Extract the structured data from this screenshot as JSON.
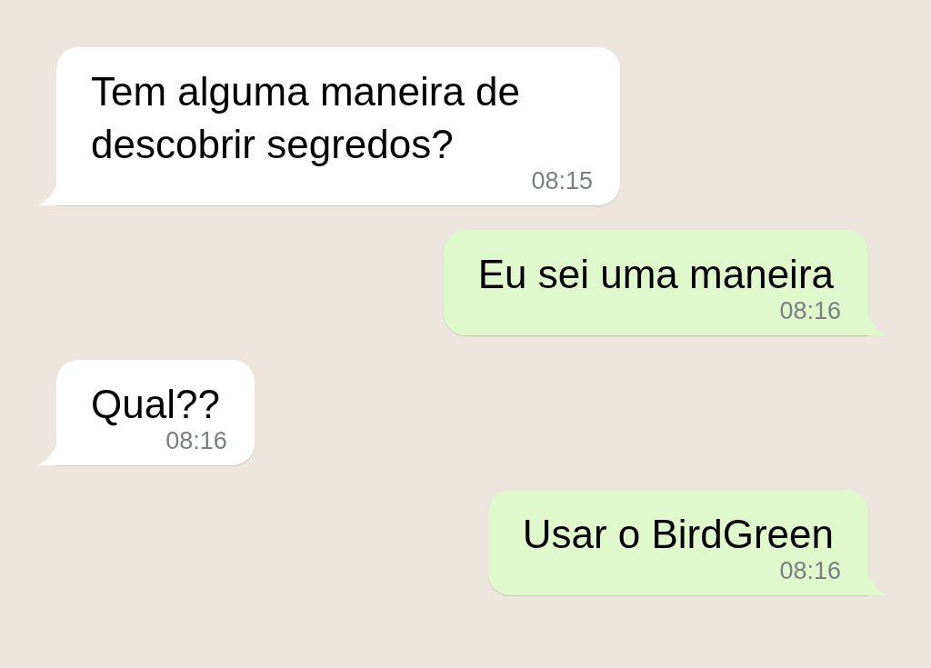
{
  "messages": [
    {
      "kind": "incoming",
      "text": "Tem alguma maneira de descobrir segredos?",
      "time": "08:15"
    },
    {
      "kind": "outgoing",
      "text": "Eu sei uma maneira",
      "time": "08:16"
    },
    {
      "kind": "incoming",
      "text": "Qual??",
      "time": "08:16"
    },
    {
      "kind": "outgoing",
      "text": "Usar o BirdGreen",
      "time": "08:16"
    }
  ]
}
